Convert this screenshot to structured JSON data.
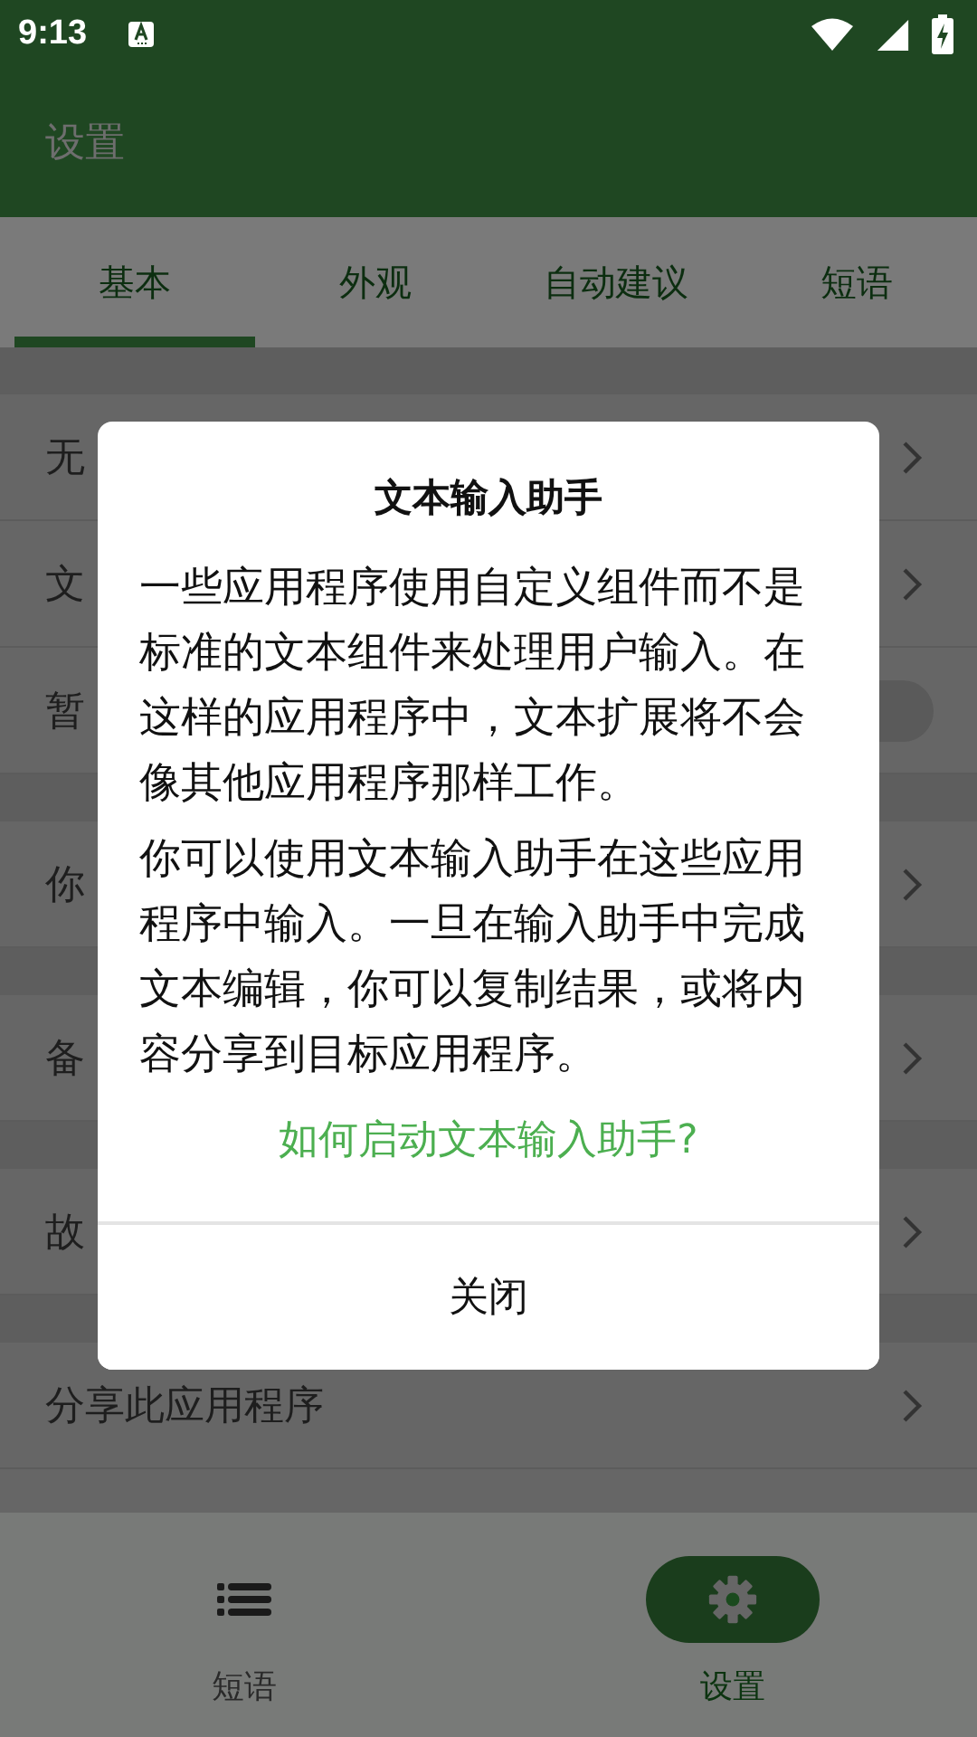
{
  "status_bar": {
    "time": "9:13"
  },
  "app_bar": {
    "title": "设置"
  },
  "tabs": [
    {
      "label": "基本",
      "selected": true
    },
    {
      "label": "外观",
      "selected": false
    },
    {
      "label": "自动建议",
      "selected": false
    },
    {
      "label": "短语",
      "selected": false
    }
  ],
  "sections": [
    {
      "items": [
        {
          "kind": "link",
          "label": "无"
        },
        {
          "kind": "link",
          "label": "文"
        },
        {
          "kind": "switch",
          "label": "暂",
          "on": false
        }
      ]
    },
    {
      "items": [
        {
          "kind": "link",
          "label": "你"
        }
      ]
    },
    {
      "items": [
        {
          "kind": "link",
          "label": "备"
        }
      ]
    },
    {
      "items": [
        {
          "kind": "link",
          "label": "故"
        }
      ]
    },
    {
      "items": [
        {
          "kind": "link",
          "label": "分享此应用程序"
        }
      ]
    }
  ],
  "bottom_nav": [
    {
      "label": "短语",
      "selected": false
    },
    {
      "label": "设置",
      "selected": true
    }
  ],
  "dialog": {
    "title": "文本输入助手",
    "paragraphs": [
      "一些应用程序使用自定义组件而不是标准的文本组件来处理用户输入。在这样的应用程序中，文本扩展将不会像其他应用程序那样工作。",
      "你可以使用文本输入助手在这些应用程序中输入。一旦在输入助手中完成文本编辑，你可以复制结果，或将内容分享到目标应用程序。"
    ],
    "link": "如何启动文本输入助手?",
    "button": "关闭"
  }
}
